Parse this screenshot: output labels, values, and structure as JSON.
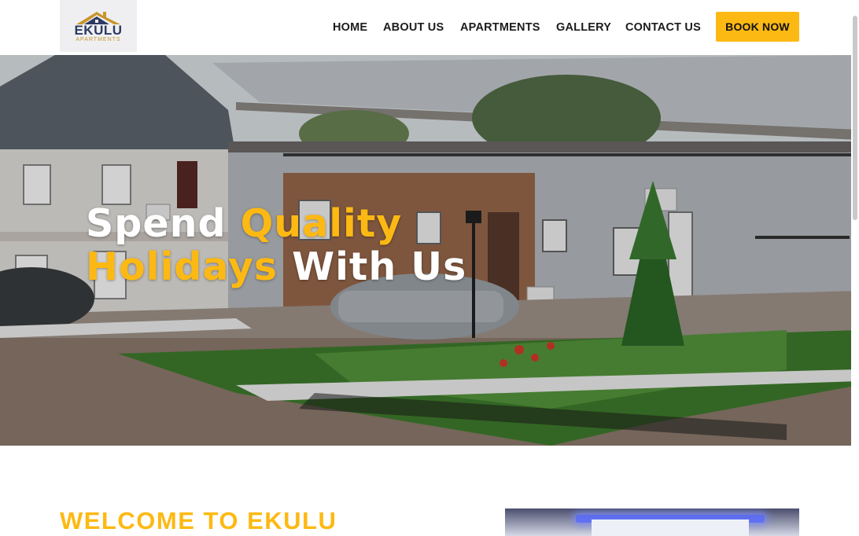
{
  "brand": {
    "logo_name": "EKULU",
    "logo_sub": "APARTMENTS",
    "accent_color": "#fdb913",
    "logo_text_color": "#2d3a63"
  },
  "nav": {
    "items": [
      "HOME",
      "ABOUT US",
      "APARTMENTS",
      "GALLERY",
      "CONTACT US"
    ],
    "cta_label": "BOOK NOW"
  },
  "hero": {
    "line1_word1": "Spend",
    "line1_word2": "Quality",
    "line2_word1": "Holidays",
    "line2_word2": "With Us"
  },
  "welcome": {
    "heading": "WELCOME TO EKULU"
  }
}
